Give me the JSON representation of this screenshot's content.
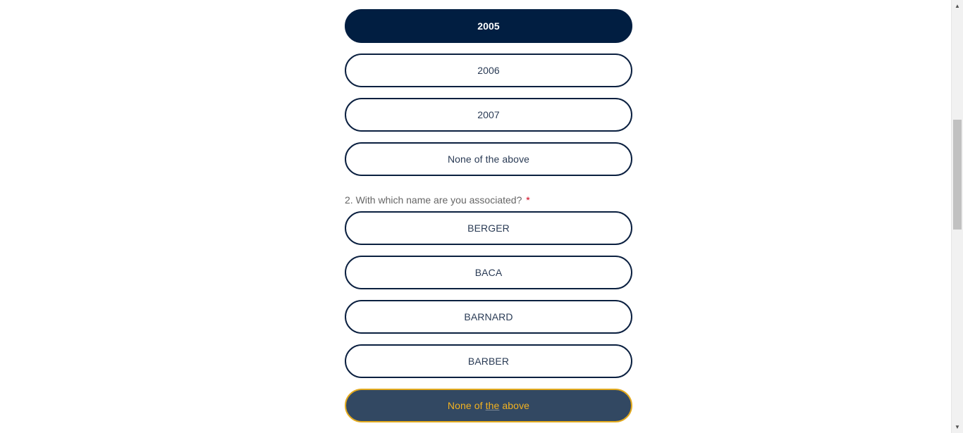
{
  "question1": {
    "options": [
      {
        "label": "2005",
        "state": "selected"
      },
      {
        "label": "2006",
        "state": "normal"
      },
      {
        "label": "2007",
        "state": "normal"
      },
      {
        "label": "None of the above",
        "state": "normal"
      }
    ]
  },
  "question2": {
    "text": "2. With which name are you associated?",
    "required_mark": "*",
    "options": [
      {
        "label": "BERGER",
        "state": "normal"
      },
      {
        "label": "BACA",
        "state": "normal"
      },
      {
        "label": "BARNARD",
        "state": "normal"
      },
      {
        "label": "BARBER",
        "state": "normal"
      },
      {
        "label_parts": [
          "None of ",
          "the",
          " above"
        ],
        "state": "hovered"
      }
    ]
  },
  "scrollbar": {
    "up_arrow_icon": "▲",
    "down_arrow_icon": "▼"
  },
  "colors": {
    "selected_bg": "#011e41",
    "hover_bg": "#324862",
    "hover_text": "#f2b221",
    "border": "#0b2040",
    "required": "#d0021b"
  }
}
